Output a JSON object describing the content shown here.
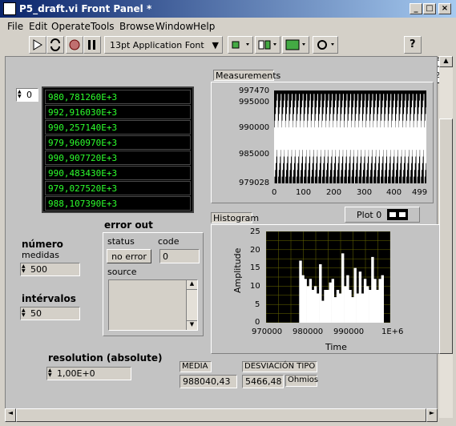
{
  "window": {
    "title": "P5_draft.vi Front Panel *",
    "min": "_",
    "max": "□",
    "close": "×"
  },
  "menu": [
    "File",
    "Edit",
    "Operate",
    "Tools",
    "Browse",
    "Window",
    "Help"
  ],
  "toolbar": {
    "font": "13pt Application Font"
  },
  "connector_pane_label": "2",
  "array": {
    "index": "0",
    "values": [
      "980,781260E+3",
      "992,916030E+3",
      "990,257140E+3",
      "979,960970E+3",
      "990,907720E+3",
      "990,483430E+3",
      "979,027520E+3",
      "988,107390E+3"
    ]
  },
  "numero": {
    "label1": "número",
    "label2": "medidas",
    "value": "500"
  },
  "intervalos": {
    "label": "intérvalos",
    "value": "50"
  },
  "resolution": {
    "label": "resolution (absolute)",
    "value": "1,00E+0"
  },
  "error_out": {
    "label": "error out",
    "status_label": "status",
    "code_label": "code",
    "status_value": "no error",
    "code_value": "0",
    "source_label": "source"
  },
  "media": {
    "label": "MEDIA",
    "value": "988040,43"
  },
  "desviacion": {
    "label": "DESVIACIÓN TIPO",
    "value": "5466,48",
    "unit": "Ohmios"
  },
  "measurements": {
    "label": "Measurements",
    "y_ticks": [
      "997470",
      "995000",
      "990000",
      "985000",
      "979028"
    ],
    "x_ticks": [
      "0",
      "100",
      "200",
      "300",
      "400",
      "499"
    ]
  },
  "histogram": {
    "label": "Histogram",
    "legend": "Plot 0",
    "ylabel": "Amplitude",
    "xlabel": "Time",
    "y_ticks": [
      "25",
      "20",
      "15",
      "10",
      "5",
      "0"
    ],
    "x_ticks": [
      "970000",
      "980000",
      "990000",
      "1E+6"
    ]
  },
  "chart_data": [
    {
      "type": "line",
      "ylim": [
        979028,
        997470
      ],
      "xlim": [
        0,
        499
      ],
      "grid": false
    },
    {
      "type": "bar",
      "ylim": [
        0,
        25
      ],
      "xlim": [
        970000,
        1000000
      ],
      "grid": true,
      "x": [
        978000,
        978600,
        979200,
        979800,
        980400,
        981000,
        981600,
        982200,
        982800,
        983400,
        984000,
        984600,
        985200,
        985800,
        986400,
        987000,
        987600,
        988200,
        988800,
        989400,
        990000,
        990600,
        991200,
        991800,
        992400,
        993000,
        993600,
        994200,
        994800,
        995400,
        996000,
        996600,
        997200,
        997800
      ],
      "values": [
        17,
        13,
        12,
        10,
        12,
        9,
        10,
        8,
        16,
        6,
        9,
        9,
        11,
        12,
        7,
        9,
        8,
        19,
        10,
        13,
        9,
        7,
        15,
        8,
        14,
        8,
        12,
        10,
        9,
        18,
        12,
        9,
        12,
        13
      ]
    }
  ]
}
